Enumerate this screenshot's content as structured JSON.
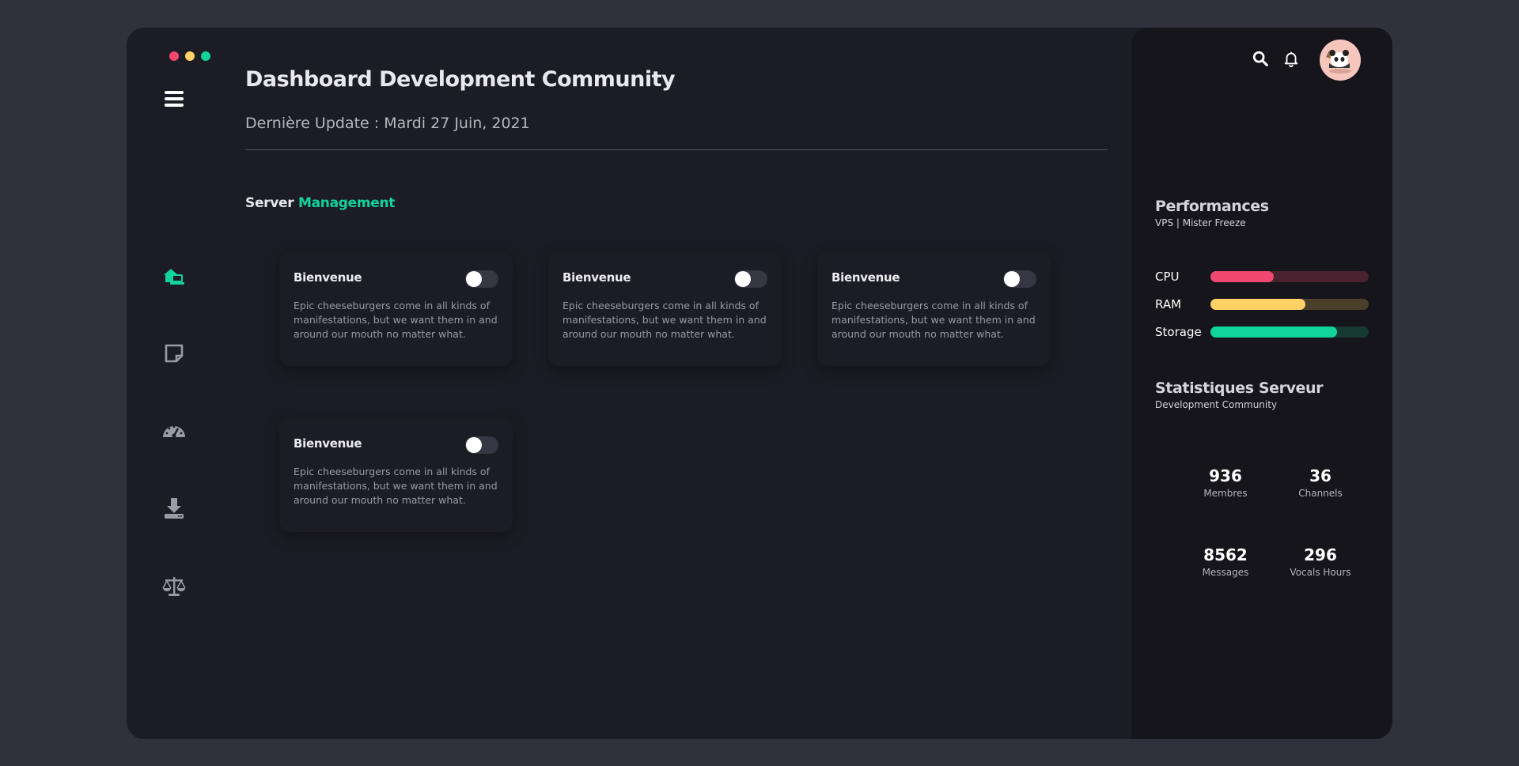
{
  "window": {
    "dots": [
      {
        "color": "#ef476f"
      },
      {
        "color": "#ffd166"
      },
      {
        "color": "#12d39a"
      }
    ]
  },
  "nav": {
    "items": [
      {
        "icon": "house-laptop-icon",
        "active": true
      },
      {
        "icon": "sticky-note-icon",
        "active": false
      },
      {
        "icon": "gauge-icon",
        "active": false
      },
      {
        "icon": "download-icon",
        "active": false
      },
      {
        "icon": "balance-scale-icon",
        "active": false
      }
    ],
    "accent": "#12d39a",
    "inactive_color": "#9b9ba8"
  },
  "header": {
    "title": "Dashboard Development Community",
    "subtitle": "Dernière Update : Mardi 27 Juin, 2021"
  },
  "section": {
    "title_prefix": "Server",
    "title_accent": "Management"
  },
  "cards": [
    {
      "title": "Bienvenue",
      "text": "Epic cheeseburgers come in all kinds of manifestations, but we want them in and around our mouth no matter what.",
      "toggle_on": false
    },
    {
      "title": "Bienvenue",
      "text": "Epic cheeseburgers come in all kinds of manifestations, but we want them in and around our mouth no matter what.",
      "toggle_on": false
    },
    {
      "title": "Bienvenue",
      "text": "Epic cheeseburgers come in all kinds of manifestations, but we want them in and around our mouth no matter what.",
      "toggle_on": false
    },
    {
      "title": "Bienvenue",
      "text": "Epic cheeseburgers come in all kinds of manifestations, but we want them in and around our mouth no matter what.",
      "toggle_on": false
    }
  ],
  "right_panel": {
    "icons": [
      "search-icon",
      "bell-icon"
    ],
    "performances": {
      "title": "Performances",
      "subtitle": "VPS | Mister Freeze",
      "bars": [
        {
          "label": "CPU",
          "value": 0.4,
          "color": "#ef476f",
          "track": "#4a2230"
        },
        {
          "label": "RAM",
          "value": 0.6,
          "color": "#ffd166",
          "track": "#4a402a"
        },
        {
          "label": "Storage",
          "value": 0.8,
          "color": "#12d39a",
          "track": "#153a30"
        }
      ]
    },
    "stats": {
      "title": "Statistiques Serveur",
      "subtitle": "Development Community",
      "items": [
        {
          "value": "936",
          "label": "Membres"
        },
        {
          "value": "36",
          "label": "Channels"
        },
        {
          "value": "8562",
          "label": "Messages"
        },
        {
          "value": "296",
          "label": "Vocals Hours"
        }
      ]
    }
  }
}
